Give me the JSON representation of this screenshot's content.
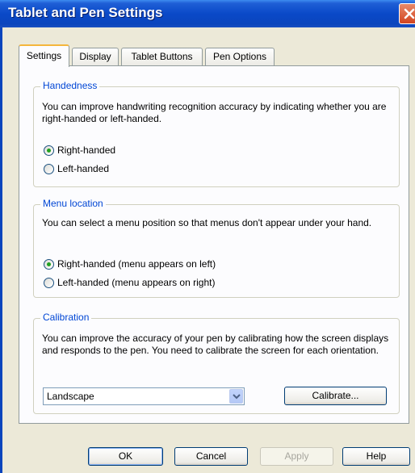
{
  "window": {
    "title": "Tablet and Pen Settings"
  },
  "tabs": [
    {
      "label": "Settings",
      "active": true
    },
    {
      "label": "Display",
      "active": false
    },
    {
      "label": "Tablet Buttons",
      "active": false
    },
    {
      "label": "Pen Options",
      "active": false
    }
  ],
  "handedness": {
    "title": "Handedness",
    "description": "You can improve handwriting recognition accuracy by indicating whether you are right-handed or left-handed.",
    "options": [
      {
        "label": "Right-handed",
        "selected": true
      },
      {
        "label": "Left-handed",
        "selected": false
      }
    ]
  },
  "menu_location": {
    "title": "Menu location",
    "description": "You can select a menu position so that menus don't appear under your hand.",
    "options": [
      {
        "label": "Right-handed (menu appears on left)",
        "selected": true
      },
      {
        "label": "Left-handed (menu appears on right)",
        "selected": false
      }
    ]
  },
  "calibration": {
    "title": "Calibration",
    "description": "You can improve the accuracy of your pen by calibrating how the screen displays and responds to the pen. You need to calibrate the screen for each orientation.",
    "orientation_value": "Landscape",
    "calibrate_label": "Calibrate..."
  },
  "buttons": {
    "ok": "OK",
    "cancel": "Cancel",
    "apply": "Apply",
    "help": "Help"
  },
  "colors": {
    "title_bar": "#0A49C8",
    "group_title": "#0046D5",
    "dialog_bg": "#ECE9D8",
    "active_tab_accent": "#F4B63C"
  }
}
